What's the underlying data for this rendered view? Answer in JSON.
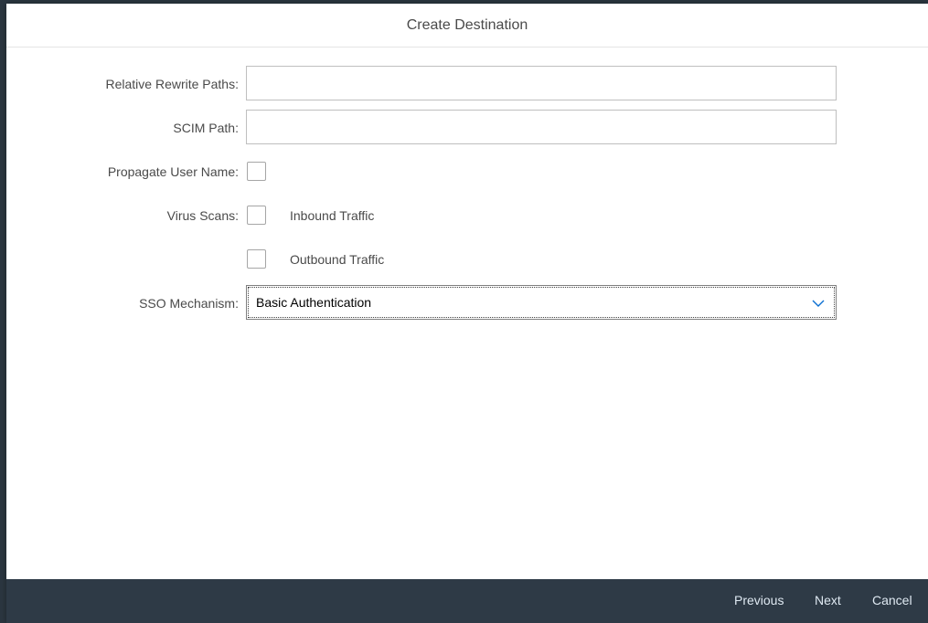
{
  "dialog": {
    "title": "Create Destination"
  },
  "form": {
    "relative_rewrite_paths": {
      "label": "Relative Rewrite Paths:",
      "value": ""
    },
    "scim_path": {
      "label": "SCIM Path:",
      "value": ""
    },
    "propagate_user_name": {
      "label": "Propagate User Name:",
      "checked": false
    },
    "virus_scans": {
      "label": "Virus Scans:",
      "options": [
        {
          "label": "Inbound Traffic",
          "checked": false
        },
        {
          "label": "Outbound Traffic",
          "checked": false
        }
      ]
    },
    "sso_mechanism": {
      "label": "SSO Mechanism:",
      "value": "Basic Authentication"
    }
  },
  "footer": {
    "previous_label": "Previous",
    "next_label": "Next",
    "cancel_label": "Cancel"
  },
  "icons": {
    "sso_dropdown": "chevron-down-icon"
  },
  "colors": {
    "footer_bg": "#2e3a46",
    "footer_text": "#dfe9f2",
    "label_text": "#4a4a4a"
  }
}
